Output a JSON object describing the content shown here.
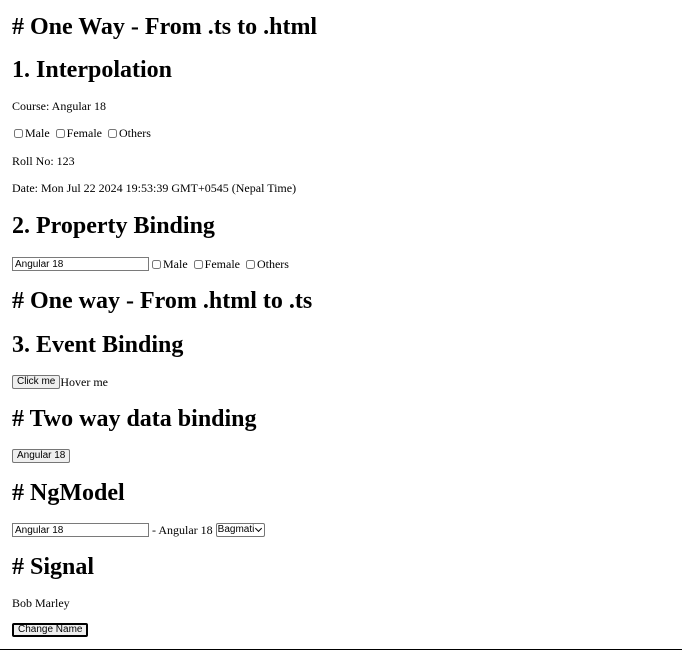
{
  "sections": {
    "one_way_ts_to_html": "# One Way - From .ts to .html",
    "interpolation": "1. Interpolation",
    "property_binding": "2. Property Binding",
    "one_way_html_to_ts": "# One way - From .html to .ts",
    "event_binding": "3. Event Binding",
    "two_way": "# Two way data binding",
    "ngmodel": "# NgModel",
    "signal": "# Signal"
  },
  "interpolation": {
    "course_text": "Course: Angular 18",
    "gender_options": [
      "Male",
      "Female",
      "Others"
    ],
    "roll_text": "Roll No: 123",
    "date_text": "Date: Mon Jul 22 2024 19:53:39 GMT+0545 (Nepal Time)"
  },
  "property_binding": {
    "course_input_value": "Angular 18",
    "gender_options": [
      "Male",
      "Female",
      "Others"
    ]
  },
  "event_binding": {
    "click_button_label": "Click me",
    "hover_text": "Hover me"
  },
  "two_way": {
    "button_label": "Angular 18"
  },
  "ngmodel": {
    "input_value": "Angular 18",
    "echo_text": "- Angular 18",
    "select_value": "Bagmati"
  },
  "signal": {
    "name_text": "Bob Marley",
    "change_button_label": "Change Name"
  }
}
